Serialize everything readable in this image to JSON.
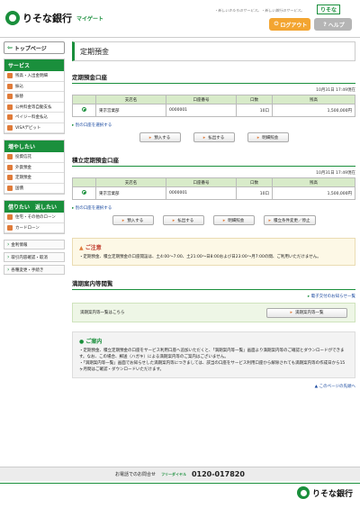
{
  "header": {
    "brand": "りそな銀行",
    "service": "マイゲート",
    "tagline": "・新しいかたちのサービス。・新しい銀行のサービス。",
    "brand_small": "りそな",
    "logout": "ログアウト",
    "help": "ヘルプ"
  },
  "sidebar": {
    "top_page": "トップページ",
    "groups": [
      {
        "title": "サービス",
        "items": [
          "残高・入出金明細",
          "振込",
          "振替",
          "公共料金等自動支払",
          "ペイジー料金払込",
          "VISAデビット"
        ]
      },
      {
        "title": "増やしたい",
        "items": [
          "投資信託",
          "外貨預金",
          "定期預金",
          "国債"
        ]
      },
      {
        "title": "借りたい　返したい",
        "items": [
          "住宅・その他のローン",
          "カードローン"
        ]
      }
    ],
    "links": [
      "金利情報",
      "取引内容確認・取消",
      "各種変更・手続き"
    ]
  },
  "main": {
    "page_title": "定期預金",
    "regular": {
      "section_title": "定期預金口座",
      "asof": "10月31日 17:49現在",
      "columns": [
        "",
        "支店名",
        "口座番号",
        "口数",
        "残高"
      ],
      "rows": [
        {
          "branch": "東京営業部",
          "account": "0000001",
          "count": "10口",
          "balance": "1,500,000円"
        }
      ],
      "other_link": "別の口座を選択する",
      "buttons": [
        "預入する",
        "払出する",
        "明細照会"
      ]
    },
    "installment": {
      "section_title": "積立定期預金口座",
      "asof": "10月31日 17:49現在",
      "columns": [
        "",
        "支店名",
        "口座番号",
        "口数",
        "残高"
      ],
      "rows": [
        {
          "branch": "東京営業部",
          "account": "0000001",
          "count": "10口",
          "balance": "1,500,000円"
        }
      ],
      "other_link": "別の口座を選択する",
      "buttons": [
        "預入する",
        "払出する",
        "明細照会",
        "積立条件変更／停止"
      ]
    },
    "notice": {
      "title": "ご注意",
      "text": "・定期預金、積立定期預金の口座開設は、土4:00〜7:00、土21:00〜日8:00および日23:00〜月7:00の間、ご利用いただけません。"
    },
    "maturity": {
      "section_title": "満期案内等閲覧",
      "news_link": "電子交付のお知らせ一覧",
      "list_text": "満期案内等一覧はこちら",
      "list_button": "満期案内等一覧"
    },
    "guide": {
      "title": "ご案内",
      "line1": "・定期預金、積立定期預金の口座をサービス利用口座へ追加いただくと、「満期案内等一覧」画面より満期案内等のご確認とダウンロードができます。なお、この場合、郵送（ハガキ）による満期案内等のご案内はございません。",
      "line2": "・「満期案内等一覧」画面でお知らせした満期案内等につきましては、該当の口座をサービス利用口座から解除されても満期案内等の作成日から15ヶ月間はご確認・ダウンロードいただけます。"
    },
    "to_top": "このページの先頭へ"
  },
  "footer": {
    "phone_label": "お電話でのお問合せ",
    "freedial": "フリーダイヤル",
    "phone": "0120-017820",
    "brand": "りそな銀行"
  }
}
